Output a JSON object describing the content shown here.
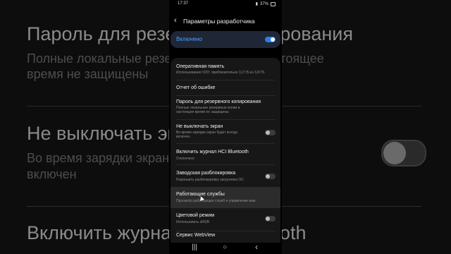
{
  "background": {
    "title1": "Пароль для резервного копирования",
    "sub1a": "Полные локальные резервные копии в настоящее",
    "sub1b": "время не защищены",
    "title2": "Не выключать экран",
    "sub2a": "Во время зарядки экран будет всегда",
    "sub2b": "включен",
    "title3": "Включить журнал HCI Bluetooth"
  },
  "status": {
    "time": "17:37",
    "battery": "37%"
  },
  "header": {
    "title": "Параметры разработчика"
  },
  "master_switch": {
    "label": "Включено",
    "on": true
  },
  "items": [
    {
      "title": "Оперативная память",
      "sub": "Использование ОЗУ: приблизительно 3,2 ГБ из 3,8 ГБ"
    },
    {
      "title": "Отчет об ошибке"
    },
    {
      "title": "Пароль для резервного копирования",
      "sub": "Полные локальные резервные копии в настоящее время не защищены"
    },
    {
      "title": "Не выключать экран",
      "sub": "Во время зарядки экран будет всегда включен",
      "toggle": false
    },
    {
      "title": "Включить журнал HCI Bluetooth",
      "sub": "Отключено"
    },
    {
      "title": "Заводская разблокировка",
      "sub": "Разрешить разблокировку загрузчика ОС",
      "toggle": false
    },
    {
      "title": "Работающие службы",
      "sub": "Просмотр работающих служб и управление ими"
    },
    {
      "title": "Цветовой режим",
      "sub": "Использовать sRGB",
      "toggle": false
    },
    {
      "title": "Сервис WebView"
    }
  ],
  "nav": {
    "recents": "|||",
    "home": "○",
    "back": "‹"
  }
}
